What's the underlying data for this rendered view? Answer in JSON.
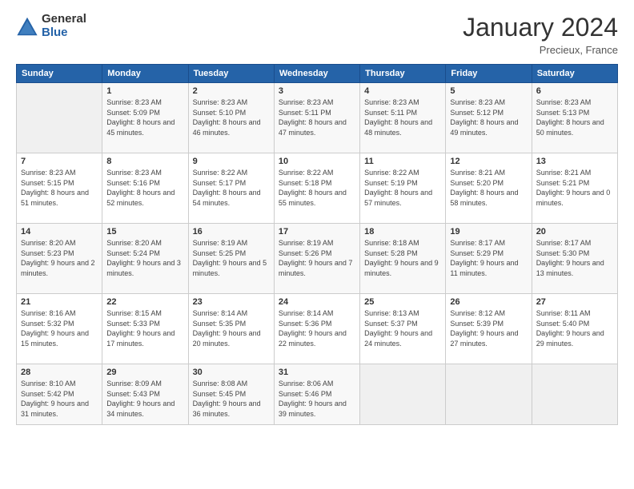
{
  "header": {
    "logo_general": "General",
    "logo_blue": "Blue",
    "month_title": "January 2024",
    "location": "Precieux, France"
  },
  "weekdays": [
    "Sunday",
    "Monday",
    "Tuesday",
    "Wednesday",
    "Thursday",
    "Friday",
    "Saturday"
  ],
  "weeks": [
    [
      {
        "day": "",
        "sunrise": "",
        "sunset": "",
        "daylight": ""
      },
      {
        "day": "1",
        "sunrise": "Sunrise: 8:23 AM",
        "sunset": "Sunset: 5:09 PM",
        "daylight": "Daylight: 8 hours and 45 minutes."
      },
      {
        "day": "2",
        "sunrise": "Sunrise: 8:23 AM",
        "sunset": "Sunset: 5:10 PM",
        "daylight": "Daylight: 8 hours and 46 minutes."
      },
      {
        "day": "3",
        "sunrise": "Sunrise: 8:23 AM",
        "sunset": "Sunset: 5:11 PM",
        "daylight": "Daylight: 8 hours and 47 minutes."
      },
      {
        "day": "4",
        "sunrise": "Sunrise: 8:23 AM",
        "sunset": "Sunset: 5:11 PM",
        "daylight": "Daylight: 8 hours and 48 minutes."
      },
      {
        "day": "5",
        "sunrise": "Sunrise: 8:23 AM",
        "sunset": "Sunset: 5:12 PM",
        "daylight": "Daylight: 8 hours and 49 minutes."
      },
      {
        "day": "6",
        "sunrise": "Sunrise: 8:23 AM",
        "sunset": "Sunset: 5:13 PM",
        "daylight": "Daylight: 8 hours and 50 minutes."
      }
    ],
    [
      {
        "day": "7",
        "sunrise": "Sunrise: 8:23 AM",
        "sunset": "Sunset: 5:15 PM",
        "daylight": "Daylight: 8 hours and 51 minutes."
      },
      {
        "day": "8",
        "sunrise": "Sunrise: 8:23 AM",
        "sunset": "Sunset: 5:16 PM",
        "daylight": "Daylight: 8 hours and 52 minutes."
      },
      {
        "day": "9",
        "sunrise": "Sunrise: 8:22 AM",
        "sunset": "Sunset: 5:17 PM",
        "daylight": "Daylight: 8 hours and 54 minutes."
      },
      {
        "day": "10",
        "sunrise": "Sunrise: 8:22 AM",
        "sunset": "Sunset: 5:18 PM",
        "daylight": "Daylight: 8 hours and 55 minutes."
      },
      {
        "day": "11",
        "sunrise": "Sunrise: 8:22 AM",
        "sunset": "Sunset: 5:19 PM",
        "daylight": "Daylight: 8 hours and 57 minutes."
      },
      {
        "day": "12",
        "sunrise": "Sunrise: 8:21 AM",
        "sunset": "Sunset: 5:20 PM",
        "daylight": "Daylight: 8 hours and 58 minutes."
      },
      {
        "day": "13",
        "sunrise": "Sunrise: 8:21 AM",
        "sunset": "Sunset: 5:21 PM",
        "daylight": "Daylight: 9 hours and 0 minutes."
      }
    ],
    [
      {
        "day": "14",
        "sunrise": "Sunrise: 8:20 AM",
        "sunset": "Sunset: 5:23 PM",
        "daylight": "Daylight: 9 hours and 2 minutes."
      },
      {
        "day": "15",
        "sunrise": "Sunrise: 8:20 AM",
        "sunset": "Sunset: 5:24 PM",
        "daylight": "Daylight: 9 hours and 3 minutes."
      },
      {
        "day": "16",
        "sunrise": "Sunrise: 8:19 AM",
        "sunset": "Sunset: 5:25 PM",
        "daylight": "Daylight: 9 hours and 5 minutes."
      },
      {
        "day": "17",
        "sunrise": "Sunrise: 8:19 AM",
        "sunset": "Sunset: 5:26 PM",
        "daylight": "Daylight: 9 hours and 7 minutes."
      },
      {
        "day": "18",
        "sunrise": "Sunrise: 8:18 AM",
        "sunset": "Sunset: 5:28 PM",
        "daylight": "Daylight: 9 hours and 9 minutes."
      },
      {
        "day": "19",
        "sunrise": "Sunrise: 8:17 AM",
        "sunset": "Sunset: 5:29 PM",
        "daylight": "Daylight: 9 hours and 11 minutes."
      },
      {
        "day": "20",
        "sunrise": "Sunrise: 8:17 AM",
        "sunset": "Sunset: 5:30 PM",
        "daylight": "Daylight: 9 hours and 13 minutes."
      }
    ],
    [
      {
        "day": "21",
        "sunrise": "Sunrise: 8:16 AM",
        "sunset": "Sunset: 5:32 PM",
        "daylight": "Daylight: 9 hours and 15 minutes."
      },
      {
        "day": "22",
        "sunrise": "Sunrise: 8:15 AM",
        "sunset": "Sunset: 5:33 PM",
        "daylight": "Daylight: 9 hours and 17 minutes."
      },
      {
        "day": "23",
        "sunrise": "Sunrise: 8:14 AM",
        "sunset": "Sunset: 5:35 PM",
        "daylight": "Daylight: 9 hours and 20 minutes."
      },
      {
        "day": "24",
        "sunrise": "Sunrise: 8:14 AM",
        "sunset": "Sunset: 5:36 PM",
        "daylight": "Daylight: 9 hours and 22 minutes."
      },
      {
        "day": "25",
        "sunrise": "Sunrise: 8:13 AM",
        "sunset": "Sunset: 5:37 PM",
        "daylight": "Daylight: 9 hours and 24 minutes."
      },
      {
        "day": "26",
        "sunrise": "Sunrise: 8:12 AM",
        "sunset": "Sunset: 5:39 PM",
        "daylight": "Daylight: 9 hours and 27 minutes."
      },
      {
        "day": "27",
        "sunrise": "Sunrise: 8:11 AM",
        "sunset": "Sunset: 5:40 PM",
        "daylight": "Daylight: 9 hours and 29 minutes."
      }
    ],
    [
      {
        "day": "28",
        "sunrise": "Sunrise: 8:10 AM",
        "sunset": "Sunset: 5:42 PM",
        "daylight": "Daylight: 9 hours and 31 minutes."
      },
      {
        "day": "29",
        "sunrise": "Sunrise: 8:09 AM",
        "sunset": "Sunset: 5:43 PM",
        "daylight": "Daylight: 9 hours and 34 minutes."
      },
      {
        "day": "30",
        "sunrise": "Sunrise: 8:08 AM",
        "sunset": "Sunset: 5:45 PM",
        "daylight": "Daylight: 9 hours and 36 minutes."
      },
      {
        "day": "31",
        "sunrise": "Sunrise: 8:06 AM",
        "sunset": "Sunset: 5:46 PM",
        "daylight": "Daylight: 9 hours and 39 minutes."
      },
      {
        "day": "",
        "sunrise": "",
        "sunset": "",
        "daylight": ""
      },
      {
        "day": "",
        "sunrise": "",
        "sunset": "",
        "daylight": ""
      },
      {
        "day": "",
        "sunrise": "",
        "sunset": "",
        "daylight": ""
      }
    ]
  ]
}
